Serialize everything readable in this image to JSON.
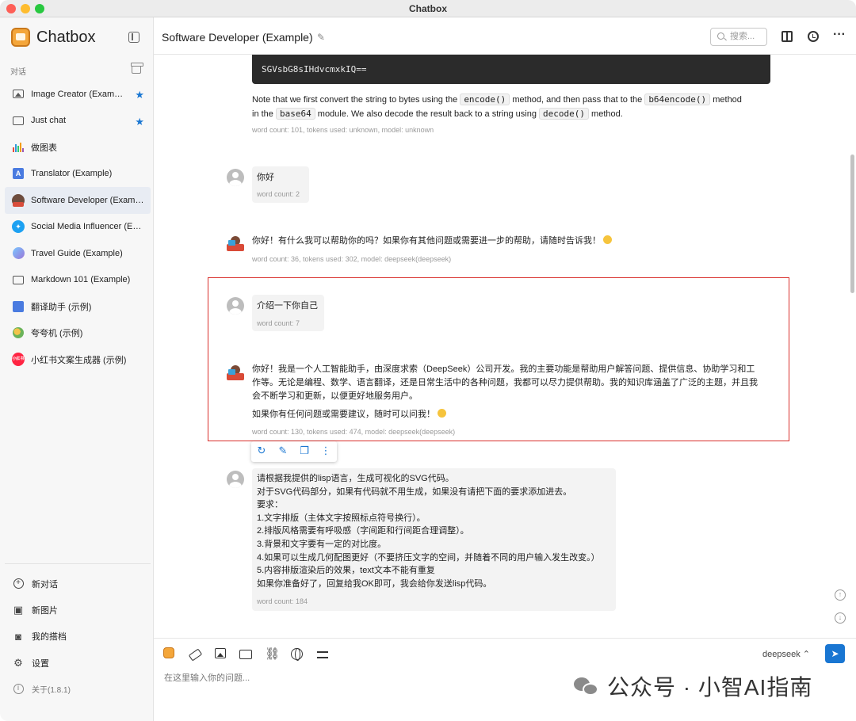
{
  "window": {
    "title": "Chatbox"
  },
  "sidebar": {
    "app_name": "Chatbox",
    "section_label": "对话",
    "conversations": [
      {
        "label": "Image Creator (Exam…",
        "icon": "image-icon",
        "starred": true
      },
      {
        "label": "Just chat",
        "icon": "chat-icon",
        "starred": true
      },
      {
        "label": "做图表",
        "icon": "chart-icon",
        "starred": false
      },
      {
        "label": "Translator (Example)",
        "icon": "translate-icon",
        "starred": false
      },
      {
        "label": "Software Developer (Exam…",
        "icon": "developer-avatar-icon",
        "starred": false,
        "active": true
      },
      {
        "label": "Social Media Influencer (E…",
        "icon": "twitter-icon",
        "starred": false
      },
      {
        "label": "Travel Guide (Example)",
        "icon": "travel-icon",
        "starred": false
      },
      {
        "label": "Markdown 101 (Example)",
        "icon": "chat-icon",
        "starred": false
      },
      {
        "label": "翻译助手 (示例)",
        "icon": "translate-icon",
        "starred": false
      },
      {
        "label": "夸夸机 (示例)",
        "icon": "flower-icon",
        "starred": false
      },
      {
        "label": "小红书文案生成器 (示例)",
        "icon": "xiaohongshu-icon",
        "starred": false
      }
    ],
    "xhs_badge": "小红书",
    "menu": {
      "new_chat": "新对话",
      "new_image": "新图片",
      "my_partners": "我的搭档",
      "settings": "设置",
      "about": "关于(1.8.1)"
    }
  },
  "header": {
    "title": "Software Developer (Example)",
    "search_placeholder": "搜索..."
  },
  "chat": {
    "code_snippet": "SGVsbG8sIHdvcmxkIQ==",
    "msg0": {
      "p1_a": "Note that we first convert the string to bytes using the ",
      "code1": "encode()",
      "p1_b": " method, and then pass that to the ",
      "code2": "b64encode()",
      "p1_c": " method",
      "p2_a": "in the ",
      "code3": "base64",
      "p2_b": " module. We also decode the result back to a string using ",
      "code4": "decode()",
      "p2_c": " method.",
      "meta": "word count: 101, tokens used: unknown, model: unknown"
    },
    "msg1": {
      "text": "你好",
      "meta": "word count: 2"
    },
    "msg2": {
      "text": "你好！有什么我可以帮助你的吗？如果你有其他问题或需要进一步的帮助，请随时告诉我！",
      "meta": "word count: 36, tokens used: 302, model: deepseek(deepseek)"
    },
    "msg3": {
      "text": "介绍一下你自己",
      "meta": "word count: 7"
    },
    "msg4": {
      "line1": "你好！我是一个人工智能助手，由深度求索（DeepSeek）公司开发。我的主要功能是帮助用户解答问题、提供信息、协助学习和工",
      "line2": "作等。无论是编程、数学、语言翻译，还是日常生活中的各种问题，我都可以尽力提供帮助。我的知识库涵盖了广泛的主题，并且我",
      "line3": "会不断学习和更新，以便更好地服务用户。",
      "line4": "如果你有任何问题或需要建议，随时可以问我！",
      "meta": "word count: 130, tokens used: 474, model: deepseek(deepseek)"
    },
    "msg5": {
      "lines": [
        "请根据我提供的lisp语言，生成可视化的SVG代码。",
        "对于SVG代码部分，如果有代码就不用生成，如果没有请把下面的要求添加进去。",
        "要求：",
        "1.文字排版（主体文字按照标点符号换行）。",
        "2.排版风格需要有呼吸感（字间距和行间距合理调整）。",
        "3.背景和文字要有一定的对比度。",
        "4.如果可以生成几何配图更好（不要挤压文字的空间，并随着不同的用户输入发生改变。）",
        "5.内容排版渲染后的效果，text文本不能有重复",
        "如果你准备好了，回复给我OK即可，我会给你发送lisp代码。"
      ],
      "meta": "word count: 184"
    }
  },
  "input": {
    "placeholder": "在这里输入你的问题...",
    "model": "deepseek",
    "watermark": "公众号 · 小智AI指南"
  },
  "colors": {
    "accent": "#1976d2",
    "highlight": "#d9302c"
  }
}
